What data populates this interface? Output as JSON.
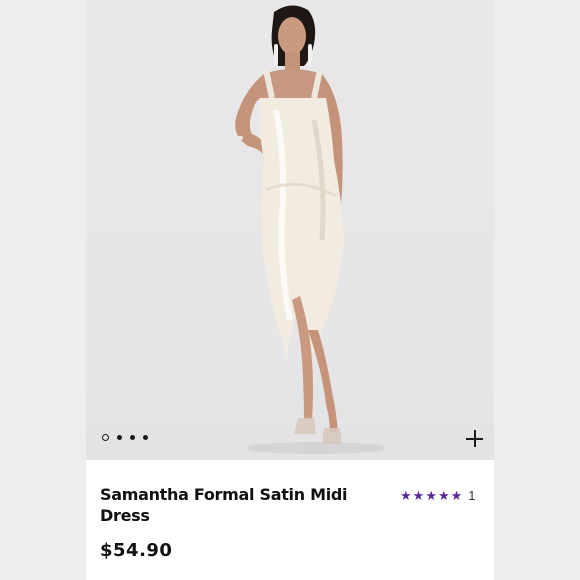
{
  "product": {
    "title": "Samantha Formal Satin Midi Dress",
    "price": "$54.90",
    "rating_count": "1",
    "rating_stars": 5,
    "star_color": "#5b2a9a"
  },
  "carousel": {
    "slide_count": 4,
    "active_index": 0
  },
  "icons": {
    "expand": "plus-icon",
    "star": "star-icon"
  }
}
